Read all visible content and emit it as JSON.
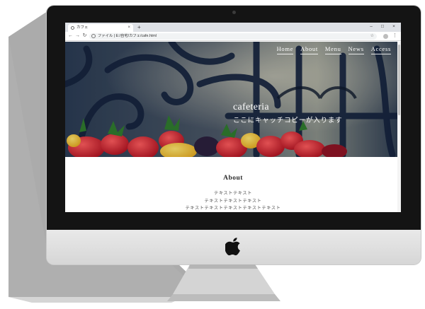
{
  "browser": {
    "tab_title": "カフェ",
    "tab_close_icon": "×",
    "new_tab_icon": "+",
    "window_controls": [
      "–",
      "□",
      "×"
    ],
    "url_info_label": "ファイル",
    "url": "E:/自宅/カフェ/cafe.html"
  },
  "site": {
    "nav": [
      "Home",
      "About",
      "Menu",
      "News",
      "Access"
    ],
    "hero_title": "cafeteria",
    "hero_catch": "ここにキャッチコピーが入ります",
    "about_heading": "About",
    "about_lines": [
      "テキストテキスト",
      "テキストテキストテキスト",
      "テキストテキストテキストテキストテキスト"
    ]
  },
  "colors": {
    "bezel": "#141414",
    "chin": "#e4e4e4",
    "hero_overlay": "#1b2a40",
    "nav_text": "#ffffff"
  },
  "icons": {
    "back": "←",
    "forward": "→",
    "reload": "↻",
    "star": "☆",
    "menu": "⋮"
  }
}
